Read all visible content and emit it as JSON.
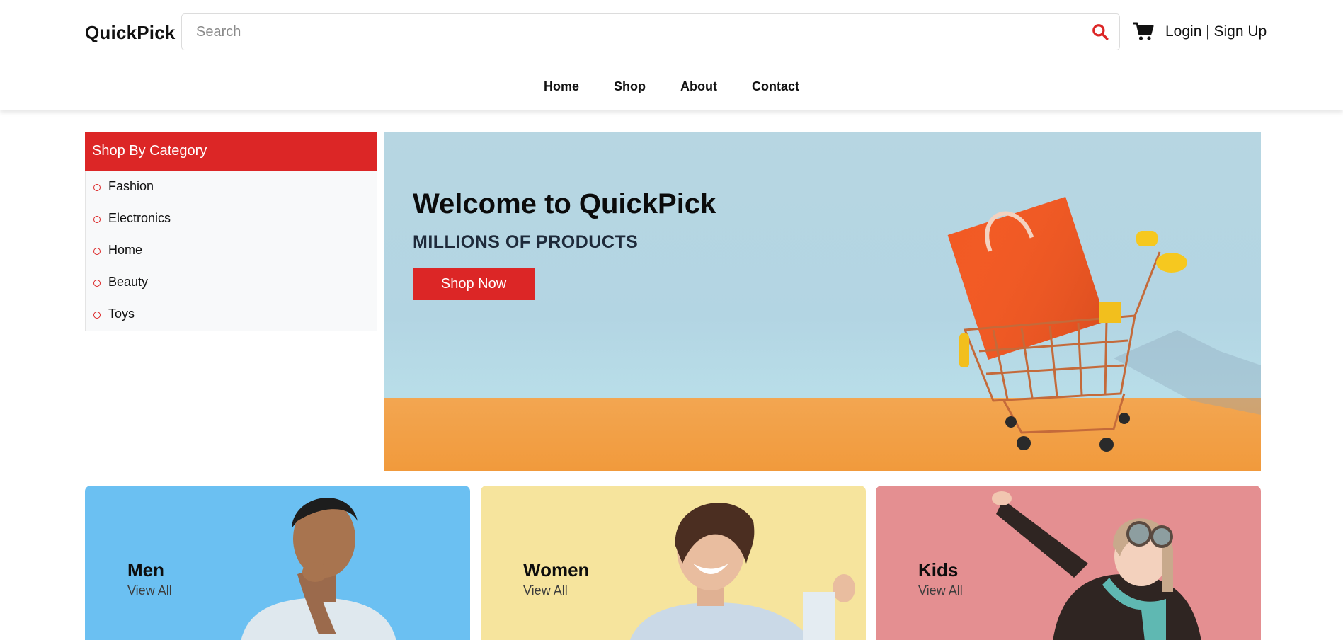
{
  "header": {
    "logo": "QuickPick",
    "search": {
      "placeholder": "Search",
      "value": ""
    },
    "search_icon": "search-icon",
    "cart_icon": "cart-icon",
    "auth_label": "Login | Sign Up",
    "nav": [
      {
        "label": "Home"
      },
      {
        "label": "Shop"
      },
      {
        "label": "About"
      },
      {
        "label": "Contact"
      }
    ]
  },
  "sidebar": {
    "title": "Shop By Category",
    "items": [
      {
        "label": "Fashion"
      },
      {
        "label": "Electronics"
      },
      {
        "label": "Home"
      },
      {
        "label": "Beauty"
      },
      {
        "label": "Toys"
      }
    ]
  },
  "hero": {
    "title": "Welcome to QuickPick",
    "subtitle": "MILLIONS OF PRODUCTS",
    "button": "Shop Now"
  },
  "cards": [
    {
      "title": "Men",
      "link": "View All",
      "color": "#6bc0f2"
    },
    {
      "title": "Women",
      "link": "View All",
      "color": "#f6e49d"
    },
    {
      "title": "Kids",
      "link": "View All",
      "color": "#e48f91"
    }
  ],
  "colors": {
    "accent": "#dc2626",
    "floor": "#f19a3c"
  }
}
